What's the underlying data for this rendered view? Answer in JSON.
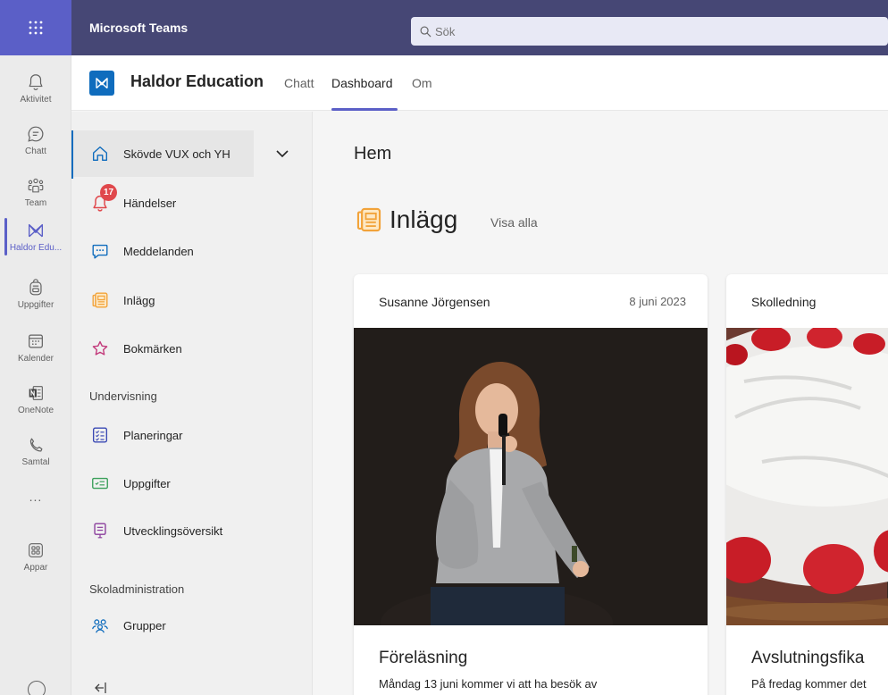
{
  "topbar": {
    "app_title": "Microsoft Teams",
    "search_placeholder": "Sök"
  },
  "rail": {
    "items": [
      {
        "label": "Aktivitet",
        "icon": "bell-icon"
      },
      {
        "label": "Chatt",
        "icon": "chat-icon"
      },
      {
        "label": "Team",
        "icon": "team-icon"
      },
      {
        "label": "Haldor Edu...",
        "icon": "haldor-icon",
        "active": true
      },
      {
        "label": "Uppgifter",
        "icon": "backpack-icon"
      },
      {
        "label": "Kalender",
        "icon": "calendar-icon"
      },
      {
        "label": "OneNote",
        "icon": "onenote-icon"
      },
      {
        "label": "Samtal",
        "icon": "phone-icon"
      },
      {
        "label": "...",
        "icon": "more-icon"
      },
      {
        "label": "Appar",
        "icon": "apps-icon"
      }
    ]
  },
  "header": {
    "app_name": "Haldor Education",
    "tabs": [
      {
        "label": "Chatt"
      },
      {
        "label": "Dashboard",
        "active": true
      },
      {
        "label": "Om"
      }
    ]
  },
  "nav": {
    "school": "Skövde VUX och YH",
    "items": [
      {
        "label": "Händelser",
        "icon": "bell-icon",
        "badge": "17"
      },
      {
        "label": "Meddelanden",
        "icon": "message-icon"
      },
      {
        "label": "Inlägg",
        "icon": "post-icon"
      },
      {
        "label": "Bokmärken",
        "icon": "star-icon"
      }
    ],
    "section_teaching": "Undervisning",
    "teaching_items": [
      {
        "label": "Planeringar",
        "icon": "checklist-icon"
      },
      {
        "label": "Uppgifter",
        "icon": "assignment-icon"
      },
      {
        "label": "Utvecklingsöversikt",
        "icon": "progress-icon"
      }
    ],
    "section_admin": "Skoladministration",
    "admin_items": [
      {
        "label": "Grupper",
        "icon": "people-icon"
      }
    ]
  },
  "main": {
    "title": "Hem",
    "section_title": "Inlägg",
    "view_all": "Visa alla",
    "posts": [
      {
        "author": "Susanne Jörgensen",
        "date": "8 juni 2023",
        "title": "Föreläsning",
        "excerpt": "Måndag 13 juni kommer vi att ha besök av"
      },
      {
        "author": "Skolledning",
        "date": "",
        "title": "Avslutningsfika",
        "excerpt": "På fredag kommer det"
      }
    ]
  },
  "colors": {
    "teams_header": "#464775",
    "teams_accent": "#5b5fc7",
    "haldor_blue": "#0f6cbd",
    "badge_red": "#e0484c"
  }
}
